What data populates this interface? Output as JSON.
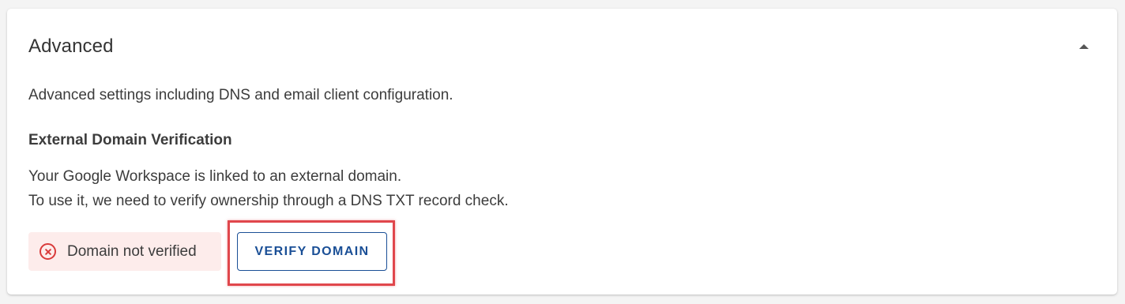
{
  "card": {
    "title": "Advanced",
    "collapse_icon": "caret-up-icon",
    "description": "Advanced settings including DNS and email client configuration."
  },
  "external_domain": {
    "title": "External Domain Verification",
    "body_lines": [
      "Your Google Workspace is linked to an external domain.",
      "To use it, we need to verify ownership through a DNS TXT record check."
    ],
    "status": {
      "icon": "error-circle-x-icon",
      "label": "Domain not verified",
      "color": "#d93a3a",
      "background": "#fdeceb"
    },
    "verify_button_label": "VERIFY DOMAIN"
  },
  "colors": {
    "accent": "#1a4f96",
    "highlight": "#e0474c"
  }
}
